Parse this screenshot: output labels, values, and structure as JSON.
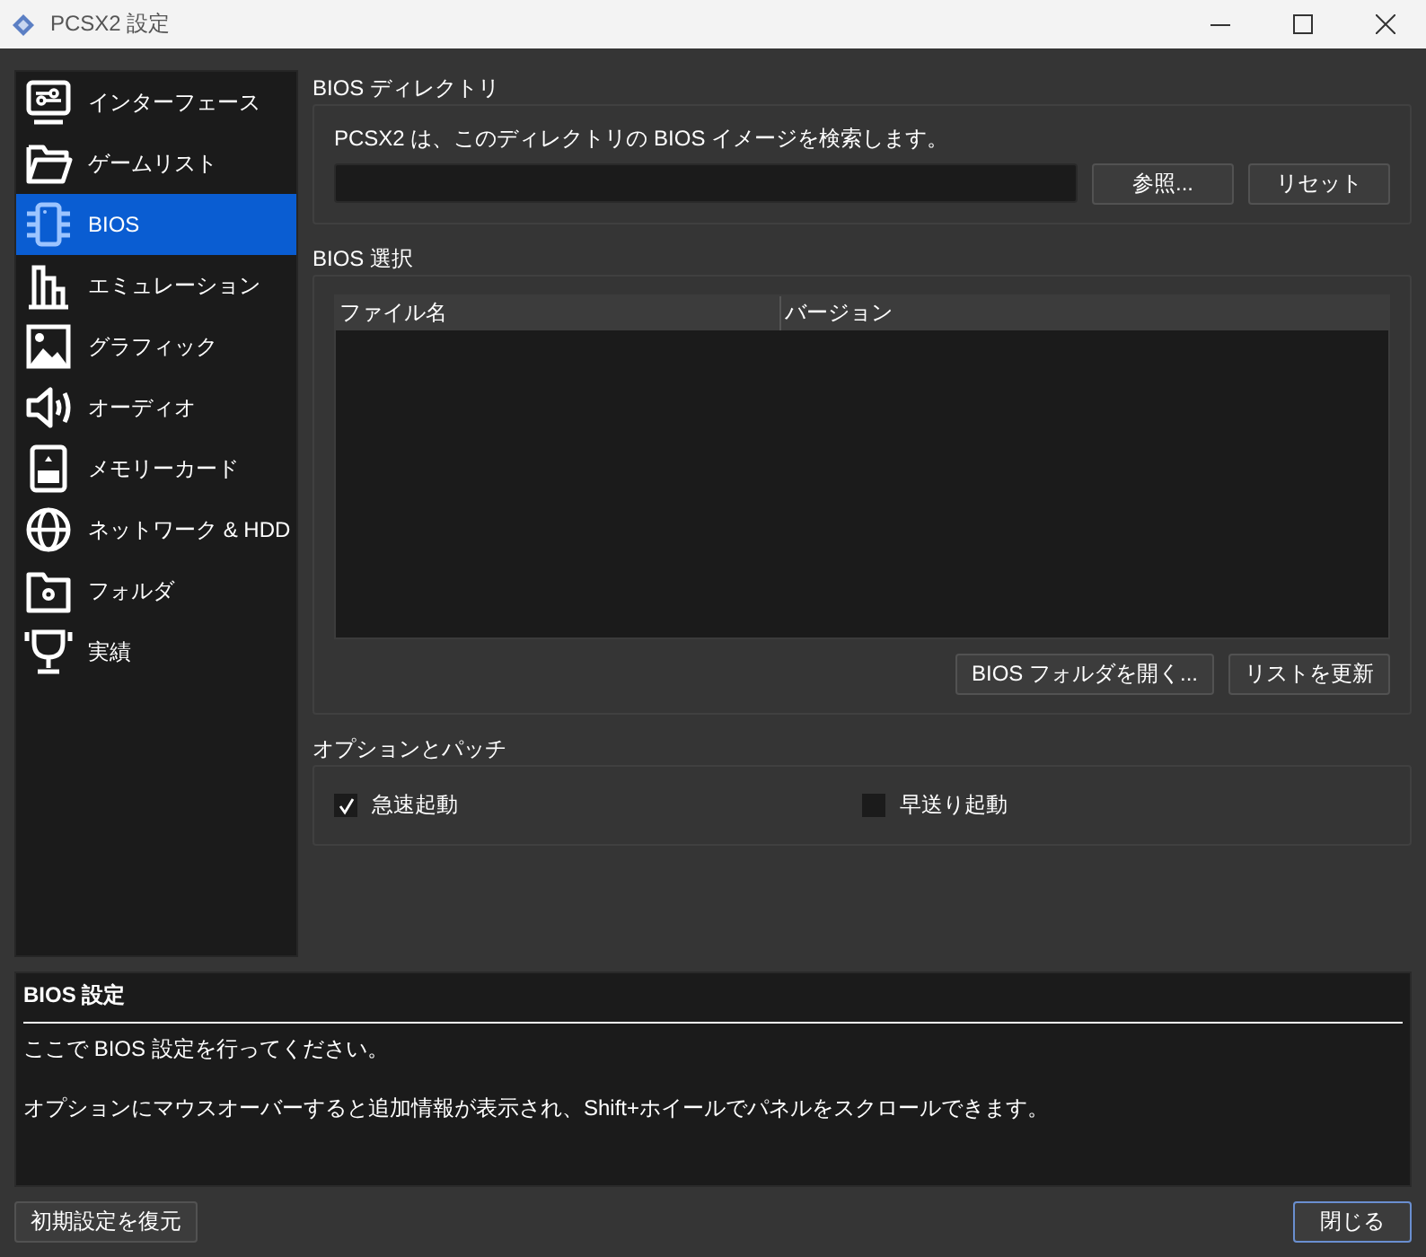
{
  "window": {
    "title": "PCSX2 設定"
  },
  "sidebar": {
    "items": [
      {
        "label": "インターフェース",
        "selected": false
      },
      {
        "label": "ゲームリスト",
        "selected": false
      },
      {
        "label": "BIOS",
        "selected": true
      },
      {
        "label": "エミュレーション",
        "selected": false
      },
      {
        "label": "グラフィック",
        "selected": false
      },
      {
        "label": "オーディオ",
        "selected": false
      },
      {
        "label": "メモリーカード",
        "selected": false
      },
      {
        "label": "ネットワーク & HDD",
        "selected": false
      },
      {
        "label": "フォルダ",
        "selected": false
      },
      {
        "label": "実績",
        "selected": false
      }
    ]
  },
  "bios_directory": {
    "title": "BIOS ディレクトリ",
    "description": "PCSX2 は、このディレクトリの BIOS イメージを検索します。",
    "browse_button": "参照...",
    "reset_button": "リセット"
  },
  "bios_selection": {
    "title": "BIOS 選択",
    "table": {
      "columns": [
        "ファイル名",
        "バージョン"
      ]
    },
    "buttons": [
      "BIOS フォルダを開く...",
      "リストを更新"
    ]
  },
  "options": {
    "title": "オプションとパッチ",
    "checkboxes": [
      {
        "label": "急速起動",
        "checked": true
      },
      {
        "label": "早送り起動",
        "checked": false
      }
    ]
  },
  "info": {
    "title": "BIOS 設定",
    "lines": [
      "ここで BIOS 設定を行ってください。",
      "オプションにマウスオーバーすると追加情報が表示され、Shift+ホイールでパネルをスクロールできます。"
    ]
  },
  "footer": {
    "restore_button": "初期設定を復元",
    "close_button": "閉じる"
  }
}
